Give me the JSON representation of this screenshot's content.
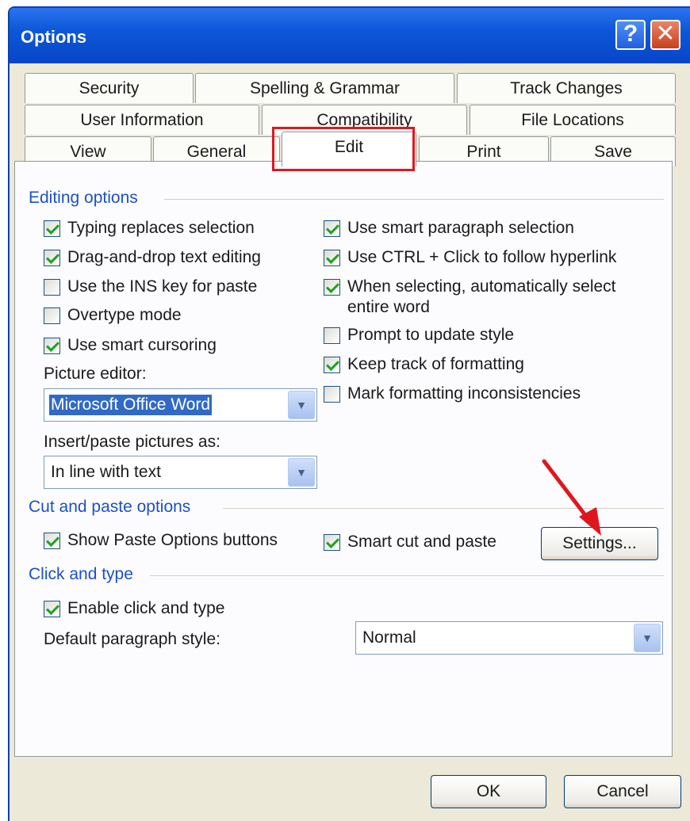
{
  "window": {
    "title": "Options"
  },
  "titlebar": {
    "help_glyph": "?",
    "close_glyph": "✕"
  },
  "tabs": {
    "row1": [
      "Security",
      "Spelling & Grammar",
      "Track Changes"
    ],
    "row2": [
      "User Information",
      "Compatibility",
      "File Locations"
    ],
    "row3": [
      "View",
      "General",
      "Edit",
      "Print",
      "Save"
    ],
    "active": "Edit"
  },
  "editing": {
    "label": "Editing options",
    "left": [
      {
        "label": "Typing replaces selection",
        "checked": true
      },
      {
        "label": "Drag-and-drop text editing",
        "checked": true
      },
      {
        "label": "Use the INS key for paste",
        "checked": false
      },
      {
        "label": "Overtype mode",
        "checked": false
      },
      {
        "label": "Use smart cursoring",
        "checked": true
      }
    ],
    "right": [
      {
        "label": "Use smart paragraph selection",
        "checked": true
      },
      {
        "label": "Use CTRL + Click to follow hyperlink",
        "checked": true
      },
      {
        "label": "When selecting, automatically select",
        "label2": "entire word",
        "checked": true
      },
      {
        "label": "Prompt to update style",
        "checked": false
      },
      {
        "label": "Keep track of formatting",
        "checked": true
      },
      {
        "label": "Mark formatting inconsistencies",
        "checked": false
      }
    ],
    "picture_editor_label": "Picture editor:",
    "picture_editor_value": "Microsoft Office Word",
    "insert_paste_label": "Insert/paste pictures as:",
    "insert_paste_value": "In line with text"
  },
  "cutpaste": {
    "label": "Cut and paste options",
    "show_paste": {
      "label": "Show Paste Options buttons",
      "checked": true
    },
    "smart_cut": {
      "label": "Smart cut and paste",
      "checked": true
    },
    "settings_button": "Settings..."
  },
  "clicktype": {
    "label": "Click and type",
    "enable": {
      "label": "Enable click and type",
      "checked": true
    },
    "default_style_label": "Default paragraph style:",
    "default_style_value": "Normal"
  },
  "footer": {
    "ok": "OK",
    "cancel": "Cancel"
  },
  "icons": {
    "dropdown_arrow": "▼"
  },
  "colors": {
    "titlebar": "#0d58d8",
    "group_label": "#1c50c7",
    "highlight": "#e0161f",
    "arrow": "#e0161f"
  }
}
